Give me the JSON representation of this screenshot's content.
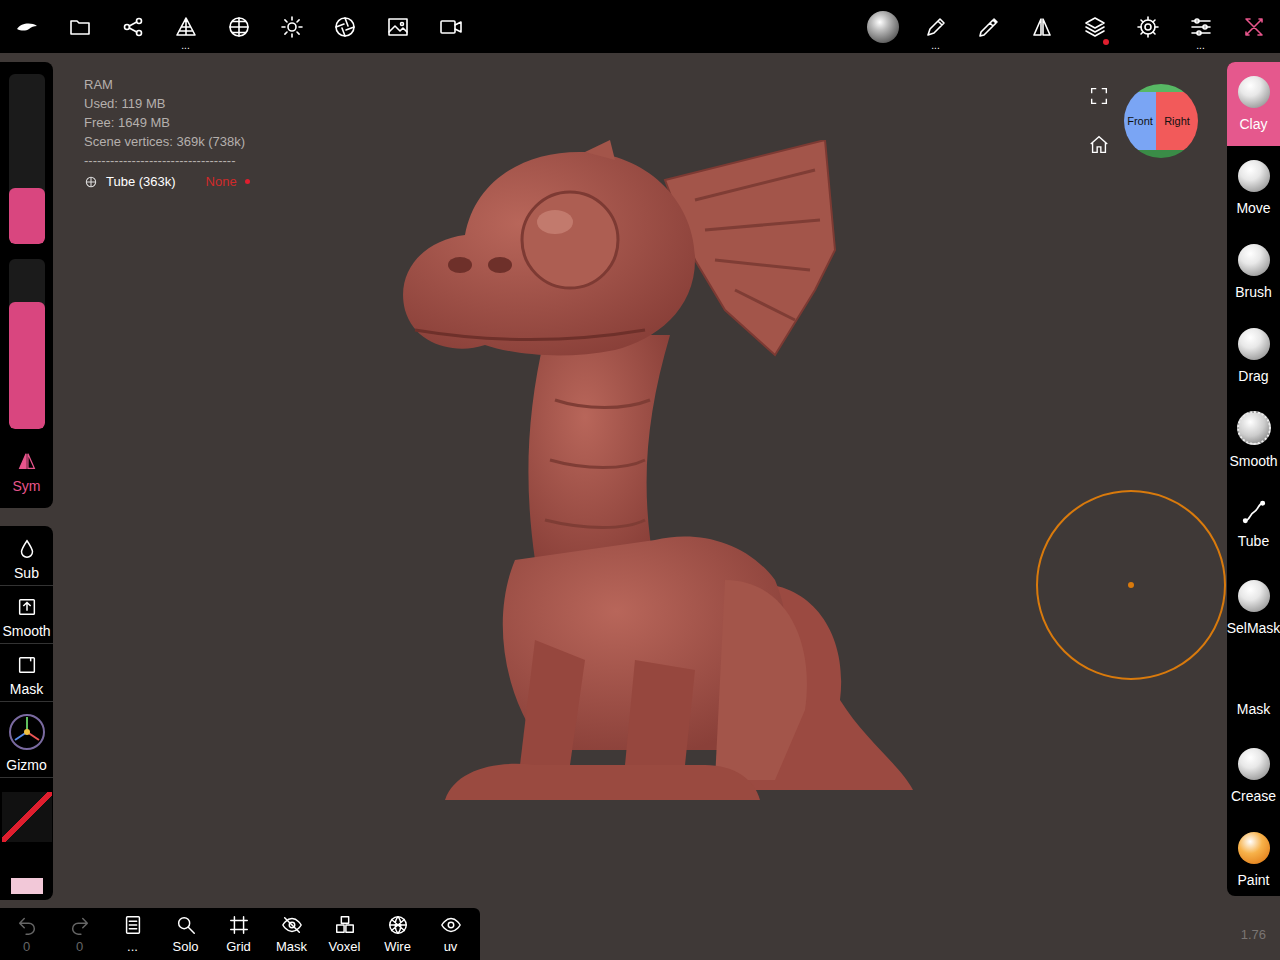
{
  "top_bar": {
    "left_items": [
      {
        "name": "app-menu"
      },
      {
        "name": "files"
      },
      {
        "name": "share"
      },
      {
        "name": "mesh",
        "dots": "..."
      },
      {
        "name": "topology"
      },
      {
        "name": "lighting"
      },
      {
        "name": "postprocess"
      },
      {
        "name": "background"
      },
      {
        "name": "camera"
      }
    ],
    "right_items": [
      {
        "name": "material"
      },
      {
        "name": "stroke",
        "dots": "..."
      },
      {
        "name": "painting"
      },
      {
        "name": "symmetry"
      },
      {
        "name": "layers",
        "badge": true
      },
      {
        "name": "settings"
      },
      {
        "name": "interface",
        "dots": "..."
      },
      {
        "name": "tools",
        "selected": true
      }
    ]
  },
  "stats": {
    "lines": [
      "RAM",
      "Used: 119 MB",
      "Free: 1649 MB",
      "Scene vertices: 369k (738k)"
    ],
    "divider": "-----------------------------------",
    "object": {
      "name": "Tube (363k)",
      "material": "None"
    }
  },
  "view_cube": {
    "front": "Front",
    "right": "Right"
  },
  "left_panel": {
    "sliders": [
      {
        "level": 0.33
      },
      {
        "level": 0.75
      }
    ],
    "symmetry": {
      "label": "Sym",
      "on": true
    },
    "tools": [
      {
        "label": "Sub"
      },
      {
        "label": "Smooth"
      },
      {
        "label": "Mask"
      },
      {
        "label": "Gizmo"
      }
    ]
  },
  "tools": [
    {
      "label": "Clay",
      "selected": true
    },
    {
      "label": "Move",
      "selected": false
    },
    {
      "label": "Brush",
      "selected": false
    },
    {
      "label": "Drag",
      "selected": false
    },
    {
      "label": "Smooth",
      "selected": false
    },
    {
      "label": "Tube",
      "selected": false
    },
    {
      "label": "SelMask",
      "selected": false
    },
    {
      "label": "Mask",
      "selected": false
    },
    {
      "label": "Crease",
      "selected": false
    },
    {
      "label": "Paint",
      "selected": false
    }
  ],
  "bottom_bar": [
    {
      "name": "undo",
      "label": "0",
      "disabled": true
    },
    {
      "name": "redo",
      "label": "0",
      "disabled": true
    },
    {
      "name": "scene",
      "label": "...",
      "disabled": false
    },
    {
      "name": "solo",
      "label": "Solo",
      "disabled": false
    },
    {
      "name": "grid",
      "label": "Grid",
      "disabled": false
    },
    {
      "name": "mask",
      "label": "Mask",
      "disabled": false
    },
    {
      "name": "voxel",
      "label": "Voxel",
      "disabled": false
    },
    {
      "name": "wire",
      "label": "Wire",
      "disabled": false
    },
    {
      "name": "uv",
      "label": "uv",
      "disabled": false
    }
  ],
  "version": "1.76"
}
